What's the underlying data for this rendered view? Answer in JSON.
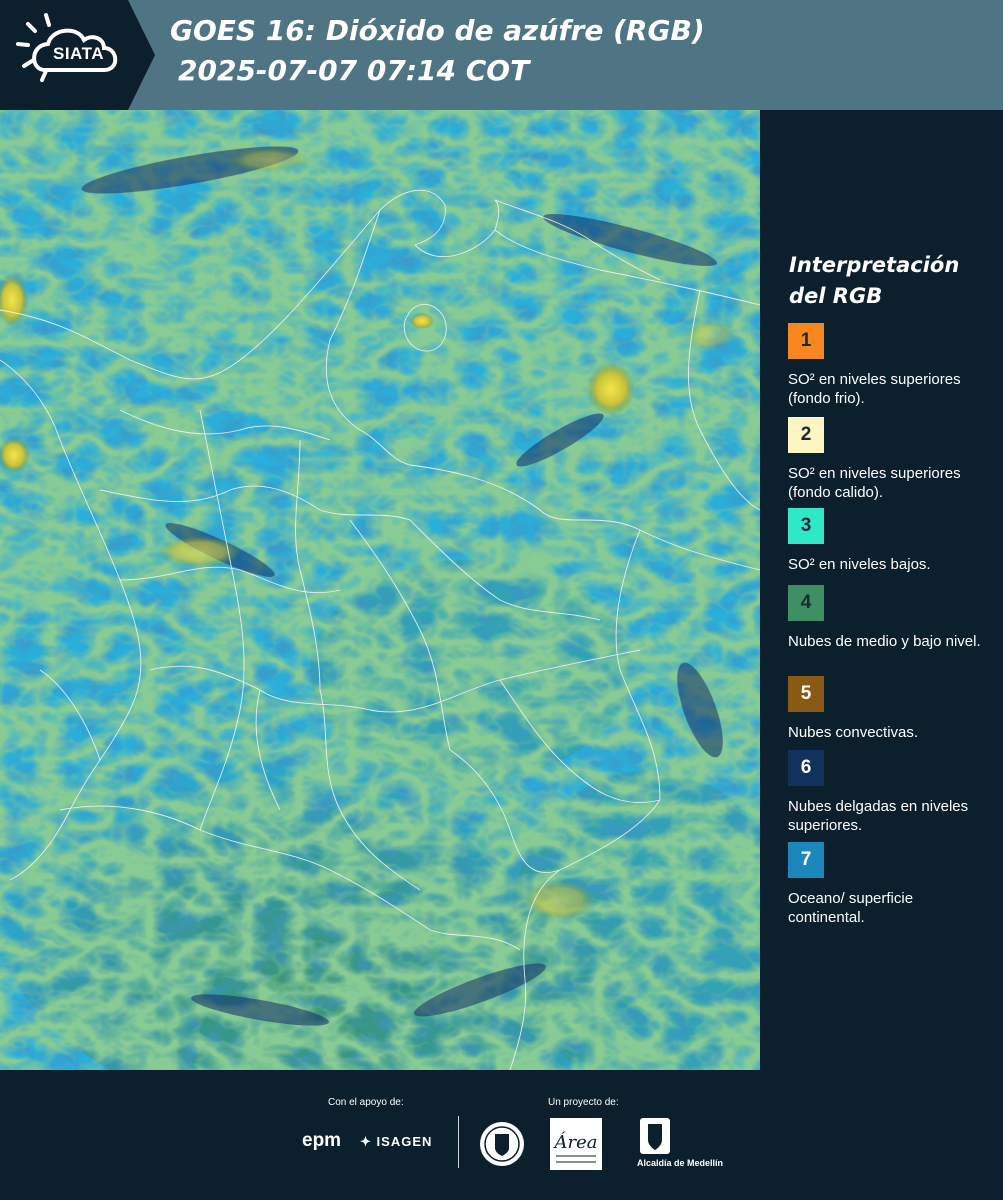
{
  "header": {
    "logo_text": "SIATA",
    "title_line1": "GOES 16: Dióxido de azúfre (RGB)",
    "title_line2": "2025-07-07 07:14 COT"
  },
  "legend": {
    "title": "Interpretación del RGB",
    "items": [
      {
        "number": "1",
        "color": "#f7871e",
        "label": "SO² en niveles superiores (fondo frio)."
      },
      {
        "number": "2",
        "color": "#fdf6c0",
        "label": "SO² en niveles superiores (fondo calido)."
      },
      {
        "number": "3",
        "color": "#2ee8c6",
        "label": "SO² en niveles bajos."
      },
      {
        "number": "4",
        "color": "#3f8f64",
        "label": "Nubes de medio y bajo nivel."
      },
      {
        "number": "5",
        "color": "#8a5a14",
        "label": "Nubes convectivas."
      },
      {
        "number": "6",
        "color": "#12325e",
        "label": "Nubes delgadas en niveles superiores."
      },
      {
        "number": "7",
        "color": "#1b87bb",
        "label": "Oceano/ superficie continental."
      }
    ]
  },
  "footer": {
    "support_caption": "Con el apoyo de:",
    "project_caption": "Un proyecto de:",
    "sponsor_1": "epm",
    "sponsor_2": "ISAGEN",
    "partner_1": "Área",
    "partner_2": "Alcaldía de Medellín"
  }
}
